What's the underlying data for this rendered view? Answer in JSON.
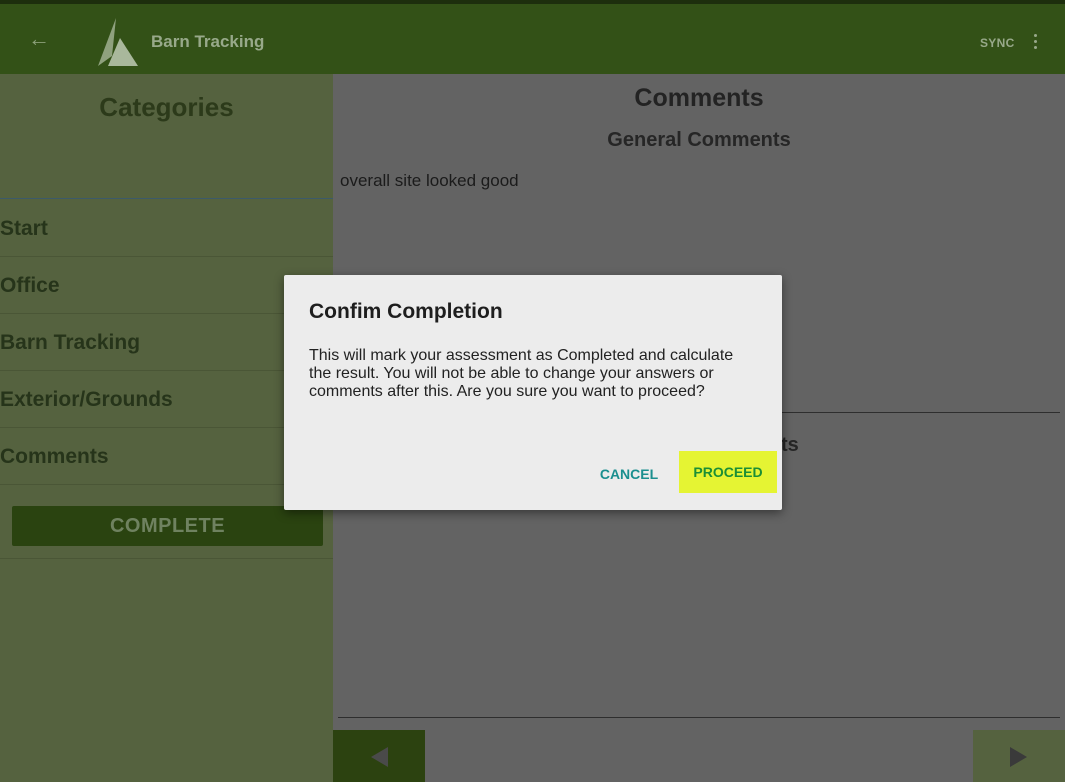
{
  "appbar": {
    "back_icon": "arrow-left-icon",
    "logo_icon": "mountain-logo-icon",
    "title": "Barn Tracking",
    "sync_label": "SYNC",
    "more_icon": "more-vertical-icon",
    "color": "#335117"
  },
  "sidebar": {
    "title": "Categories",
    "items": [
      {
        "label": "Start"
      },
      {
        "label": "Office"
      },
      {
        "label": "Barn Tracking"
      },
      {
        "label": "Exterior/Grounds"
      },
      {
        "label": "Comments"
      }
    ],
    "complete_label": "COMPLETE"
  },
  "main": {
    "section_title": "Comments",
    "general_title": "General Comments",
    "general_text": "overall site looked good",
    "second_title_visible": "ts",
    "prev_icon": "triangle-left-icon",
    "next_icon": "triangle-right-icon"
  },
  "dialog": {
    "title": "Confim Completion",
    "body": "This will mark your assessment as Completed and calculate the result. You will not be able to change your answers or comments after this. Are you sure you want to proceed?",
    "cancel_label": "CANCEL",
    "proceed_label": "PROCEED",
    "accent": "#1b8f8f",
    "highlight": "#e5f433"
  }
}
